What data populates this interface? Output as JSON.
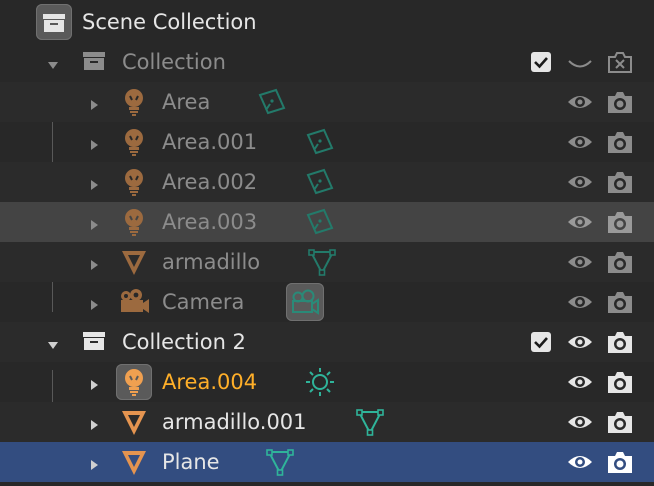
{
  "outliner": {
    "scene_collection": {
      "label": "Scene Collection",
      "icon": "scene-collection-icon"
    },
    "collections": [
      {
        "label": "Collection",
        "enabled": true,
        "visible": false,
        "render": false,
        "objects": [
          {
            "label": "Area",
            "type": "light",
            "data": "area-light-data-icon"
          },
          {
            "label": "Area.001",
            "type": "light",
            "data": "area-light-data-icon"
          },
          {
            "label": "Area.002",
            "type": "light",
            "data": "area-light-data-icon"
          },
          {
            "label": "Area.003",
            "type": "light",
            "data": "area-light-data-icon",
            "state": "hovered"
          },
          {
            "label": "armadillo",
            "type": "mesh",
            "data": "mesh-data-icon"
          },
          {
            "label": "Camera",
            "type": "camera",
            "data": "camera-data-icon"
          }
        ]
      },
      {
        "label": "Collection 2",
        "enabled": true,
        "visible": true,
        "render": true,
        "objects": [
          {
            "label": "Area.004",
            "type": "light",
            "data": "sun-light-data-icon",
            "state": "active"
          },
          {
            "label": "armadillo.001",
            "type": "mesh",
            "data": "mesh-data-icon"
          },
          {
            "label": "Plane",
            "type": "mesh",
            "data": "mesh-data-icon",
            "state": "selected"
          }
        ]
      }
    ]
  },
  "colors": {
    "background": "#282828",
    "selected_row": "#334d80",
    "hover_row": "#444444",
    "active_text": "#ffaf29",
    "object_icon": "#e49450",
    "data_icon": "#2fb49a"
  }
}
